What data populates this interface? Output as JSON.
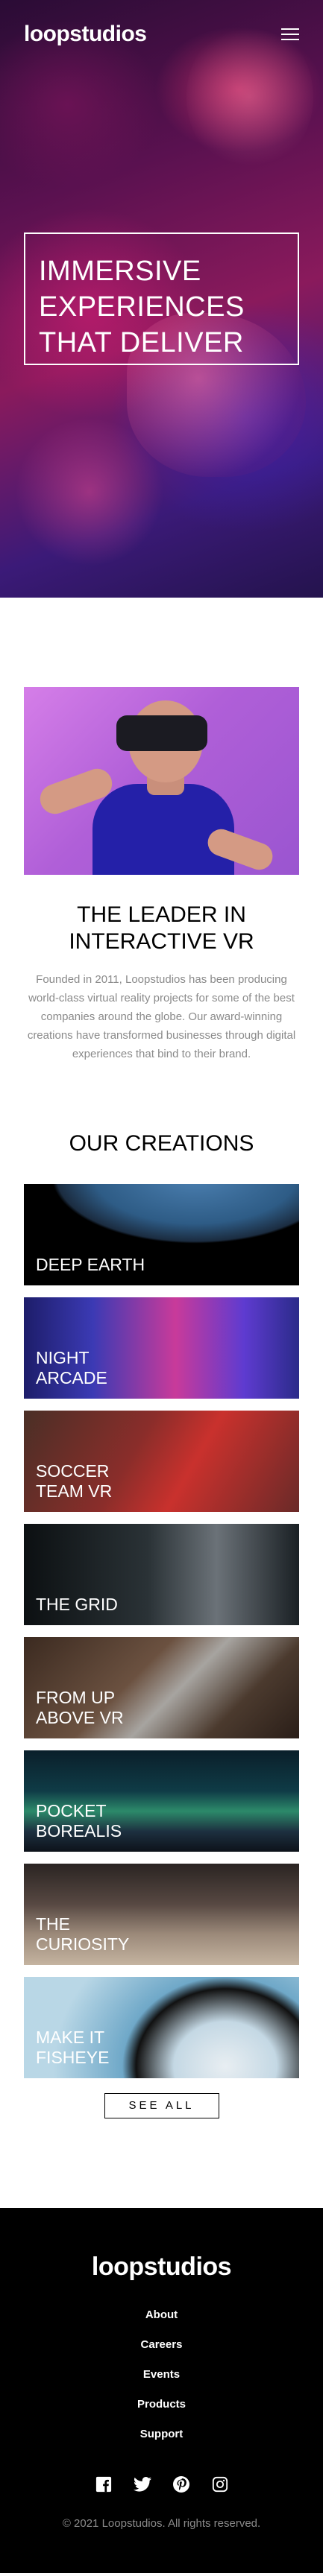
{
  "header": {
    "logo": "loopstudios",
    "menu_icon": "hamburger-menu-icon"
  },
  "hero": {
    "title": "Immersive experiences that deliver"
  },
  "about": {
    "image_alt": "man-wearing-vr-headset",
    "title": "The leader in interactive VR",
    "text": "Founded in 2011, Loopstudios has been producing world-class virtual reality projects for some of the best companies around the globe. Our award-winning creations have transformed businesses through digital experiences that bind to their brand."
  },
  "creations": {
    "title": "Our creations",
    "items": [
      {
        "label": "Deep earth"
      },
      {
        "label": "Night\narcade"
      },
      {
        "label": "Soccer\nteam VR"
      },
      {
        "label": "The grid"
      },
      {
        "label": "From up\nabove VR"
      },
      {
        "label": "Pocket\nborealis"
      },
      {
        "label": "The\ncuriosity"
      },
      {
        "label": "Make it\nfisheye"
      }
    ],
    "see_all": "See all"
  },
  "footer": {
    "logo": "loopstudios",
    "nav": [
      "About",
      "Careers",
      "Events",
      "Products",
      "Support"
    ],
    "socials": [
      "facebook-icon",
      "twitter-icon",
      "pinterest-icon",
      "instagram-icon"
    ],
    "copyright": "© 2021 Loopstudios. All rights reserved."
  },
  "colors": {
    "footer_bg": "#000000",
    "body_text_muted": "#8a8a8a",
    "hero_overlay": "#5a1150"
  }
}
